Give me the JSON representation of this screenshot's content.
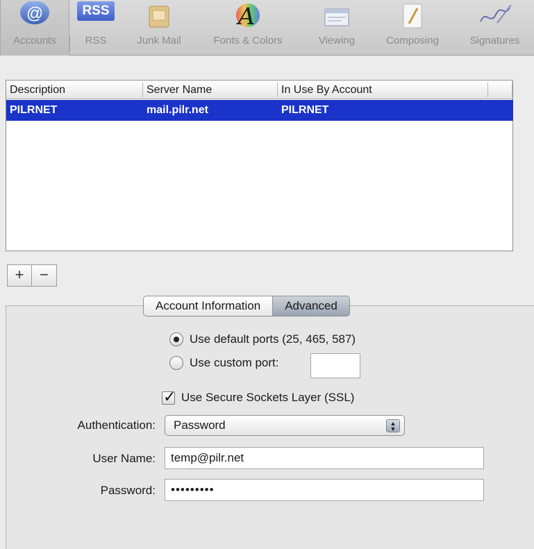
{
  "toolbar": {
    "items": [
      {
        "label": "Accounts",
        "icon": "at-sign-icon",
        "selected": true
      },
      {
        "label": "RSS",
        "icon": "rss-icon",
        "selected": false
      },
      {
        "label": "Junk Mail",
        "icon": "junk-mail-icon",
        "selected": false
      },
      {
        "label": "Fonts & Colors",
        "icon": "fonts-colors-icon",
        "selected": false
      },
      {
        "label": "Viewing",
        "icon": "viewing-icon",
        "selected": false
      },
      {
        "label": "Composing",
        "icon": "composing-icon",
        "selected": false
      },
      {
        "label": "Signatures",
        "icon": "signatures-icon",
        "selected": false
      }
    ],
    "rss_badge": "RSS",
    "fonts_glyph": "A",
    "at_glyph": "@"
  },
  "table": {
    "headers": {
      "description": "Description",
      "server": "Server Name",
      "in_use": "In Use By Account"
    },
    "rows": [
      {
        "description": "PILRNET",
        "server": "mail.pilr.net",
        "in_use": "PILRNET",
        "selected": true
      }
    ]
  },
  "buttons": {
    "add": "+",
    "remove": "−"
  },
  "tabs": {
    "account_info": "Account Information",
    "advanced": "Advanced",
    "active": "advanced"
  },
  "advanced": {
    "default_ports_label": "Use default ports (25, 465, 587)",
    "custom_port_label": "Use custom port:",
    "custom_port_value": "",
    "ssl_label": "Use Secure Sockets Layer (SSL)",
    "ssl_checked": true,
    "authentication_label": "Authentication:",
    "authentication_value": "Password",
    "user_name_label": "User Name:",
    "user_name_value": "temp@pilr.net",
    "password_label": "Password:",
    "password_value": "•••••••••"
  },
  "colors": {
    "selection": "#1a33c8",
    "toolbar_label": "#8b8b8b",
    "rss_blue": "#4f6fd6"
  }
}
